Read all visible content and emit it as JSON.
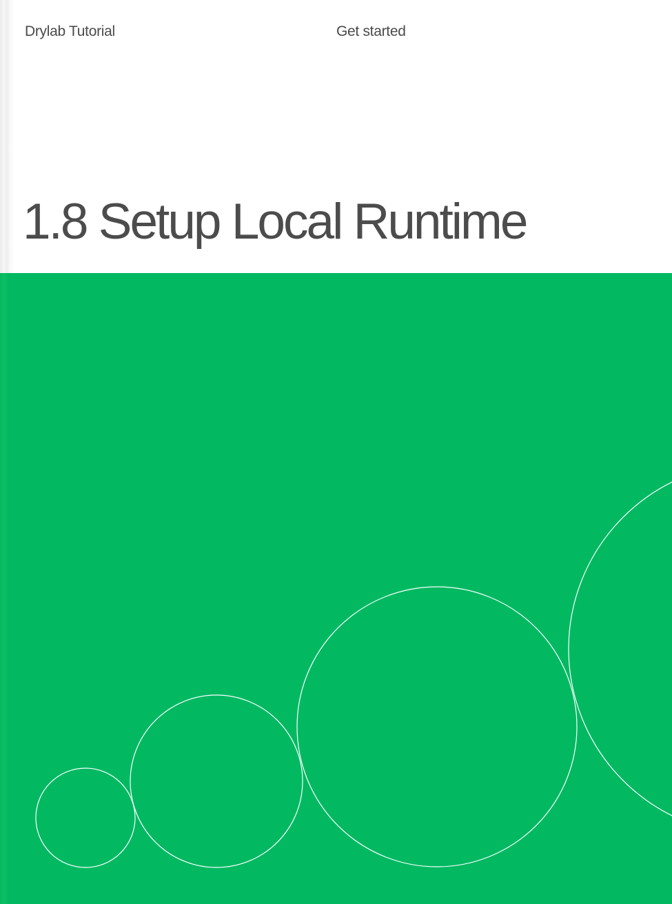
{
  "header": {
    "series_title": "Drylab Tutorial",
    "section_label": "Get started"
  },
  "page": {
    "title": "1.8 Setup Local Runtime"
  },
  "colors": {
    "cover_green": "#02b962",
    "title_text": "#4c4c4c",
    "header_text": "#4a4a4a",
    "circle_stroke": "#ffffff"
  }
}
